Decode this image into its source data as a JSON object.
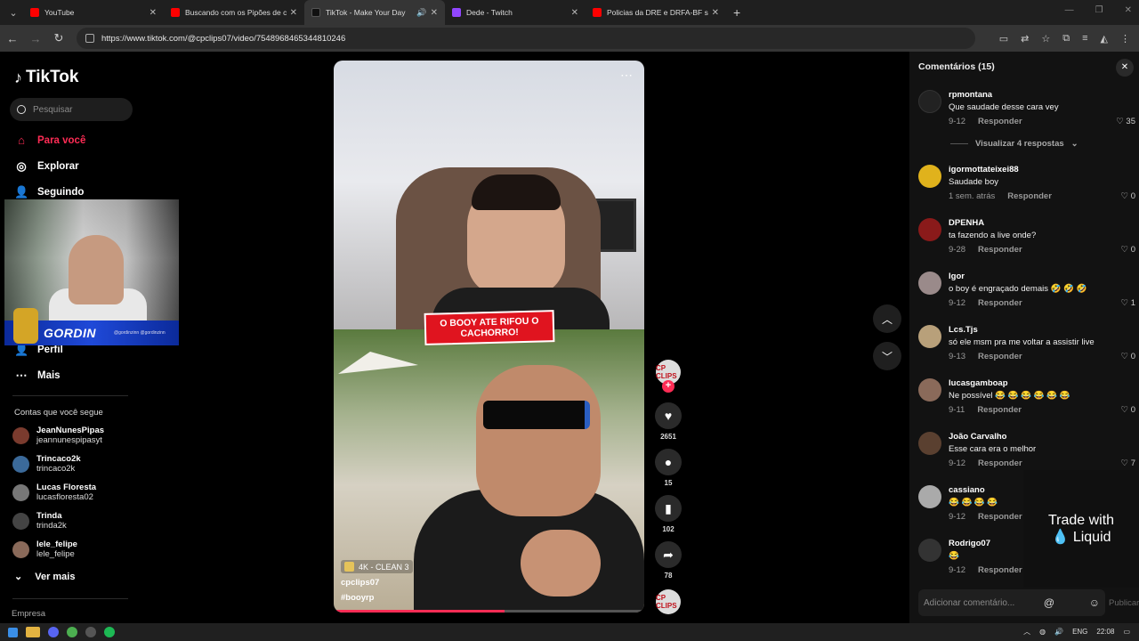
{
  "browser": {
    "tabs": [
      {
        "title": "YouTube",
        "color": "#ff0000"
      },
      {
        "title": "Buscando com os Pipões de cin",
        "color": "#ff0000"
      },
      {
        "title": "TikTok - Make Your Day",
        "color": "#111111",
        "active": true
      },
      {
        "title": "Dede - Twitch",
        "color": "#9146ff"
      },
      {
        "title": "Policias da DRE e DRFA-BF socc",
        "color": "#ff0000"
      }
    ],
    "url": "https://www.tiktok.com/@cpclips07/video/7548968465344810246"
  },
  "sidebar": {
    "logo": "TikTok",
    "search_placeholder": "Pesquisar",
    "nav": [
      {
        "label": "Para você",
        "icon": "home-icon"
      },
      {
        "label": "Explorar",
        "icon": "compass-icon"
      },
      {
        "label": "Seguindo",
        "icon": "following-icon"
      },
      {
        "label": "Perfil",
        "icon": "profile-icon"
      },
      {
        "label": "Mais",
        "icon": "more-icon"
      }
    ],
    "following_title": "Contas que você segue",
    "following": [
      {
        "name": "JeanNunesPipas",
        "handle": "jeannunespipasyt",
        "color": "#7a3b2e"
      },
      {
        "name": "Trincaco2k",
        "handle": "trincaco2k",
        "color": "#3b6a9a"
      },
      {
        "name": "Lucas Floresta",
        "handle": "lucasfloresta02",
        "color": "#777777"
      },
      {
        "name": "Trinda",
        "handle": "trinda2k",
        "color": "#444444"
      },
      {
        "name": "lele_felipe",
        "handle": "lele_felipe",
        "color": "#8a6a5a"
      }
    ],
    "see_more": "Ver mais",
    "footer": "Empresa"
  },
  "overlay": {
    "streamer_name": "GORDIN",
    "streamer_socials": "@gordinzinn   @gordinzinn"
  },
  "video": {
    "caption_overlay": "O BOOY ATE RIFOU O CACHORRO!",
    "badge": "4K - CLEAN 3",
    "author": "cpclips07",
    "hashtag": "#booyrp",
    "progress_fraction": 0.55
  },
  "actions": {
    "creator_badge": "CP CLIPS",
    "likes": "2651",
    "comments": "15",
    "saves": "102",
    "shares": "78"
  },
  "comments_panel": {
    "title": "Comentários (15)",
    "view_replies": "Visualizar 4 respostas",
    "reply_label": "Responder",
    "input_placeholder": "Adicionar comentário...",
    "publish_label": "Publicar",
    "ad_text_1": "Trade with",
    "ad_text_2": "Liquid",
    "items": [
      {
        "user": "rpmontana",
        "text": "Que saudade desse cara vey",
        "date": "9-12",
        "likes": "35",
        "color": "#222222"
      },
      {
        "user": "igormottateixei88",
        "text": "Saudade boy",
        "date": "1 sem. atrás",
        "likes": "0",
        "color": "#e0b21c"
      },
      {
        "user": "DPENHA",
        "text": "ta fazendo a live onde?",
        "date": "9-28",
        "likes": "0",
        "color": "#8a1a1a"
      },
      {
        "user": "Igor",
        "text": "o boy é engraçado demais 🤣 🤣 🤣",
        "date": "9-12",
        "likes": "1",
        "color": "#9a8a8a"
      },
      {
        "user": "Lcs.Tjs",
        "text": "só ele msm pra me voltar a assistir live",
        "date": "9-13",
        "likes": "0",
        "color": "#b8a07a"
      },
      {
        "user": "lucasgamboap",
        "text": "Ne possível 😂 😂 😂 😂 😂 😂",
        "date": "9-11",
        "likes": "0",
        "color": "#8a6a5a"
      },
      {
        "user": "João Carvalho",
        "text": "Esse cara era o melhor",
        "date": "9-12",
        "likes": "7",
        "color": "#5a4030"
      },
      {
        "user": "cassiano",
        "text": "😂 😂 😂 😂",
        "date": "9-12",
        "likes": "",
        "color": "#aaaaaa"
      },
      {
        "user": "Rodrigo07",
        "text": "😂",
        "date": "9-12",
        "likes": "",
        "color": "#333333"
      }
    ]
  },
  "taskbar": {
    "lang": "ENG",
    "time": "22:08"
  }
}
